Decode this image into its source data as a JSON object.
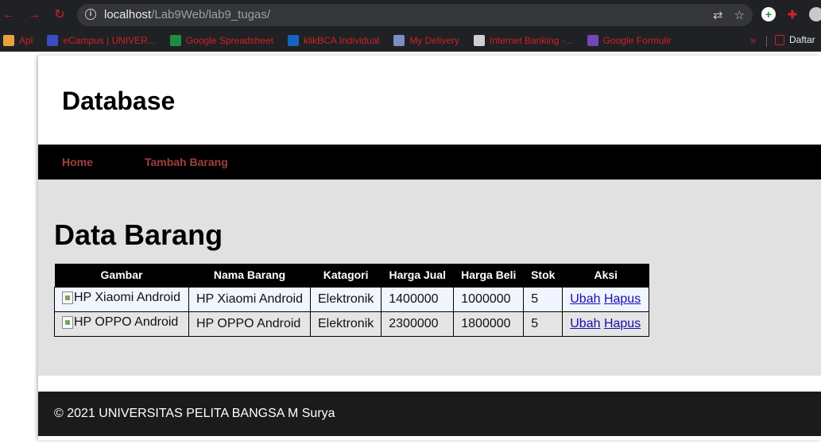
{
  "browser": {
    "url_host": "localhost",
    "url_path": "/Lab9Web/lab9_tugas/",
    "bookmarks": [
      {
        "label": "Apl",
        "color": "#e8a33d"
      },
      {
        "label": "eCampus | UNIVER...",
        "color": "#3b4cc0"
      },
      {
        "label": "Google Spreadsheet",
        "color": "#1e8e3e"
      },
      {
        "label": "klikBCA Individual",
        "color": "#1565c0"
      },
      {
        "label": "My Delivery",
        "color": "#7b8ec8"
      },
      {
        "label": "Internet Banking -...",
        "color": "#d0d0d0"
      },
      {
        "label": "Google Formulir",
        "color": "#7248b9"
      }
    ],
    "bookmarks_more": "»",
    "bookmark_daftar": "Daftar"
  },
  "header": {
    "title": "Database"
  },
  "nav": {
    "home": "Home",
    "tambah": "Tambah Barang"
  },
  "main": {
    "heading": "Data Barang",
    "columns": [
      "Gambar",
      "Nama Barang",
      "Katagori",
      "Harga Jual",
      "Harga Beli",
      "Stok",
      "Aksi"
    ],
    "rows": [
      {
        "gambar_alt": "HP Xiaomi Android",
        "nama": "HP Xiaomi Android",
        "kategori": "Elektronik",
        "harga_jual": "1400000",
        "harga_beli": "1000000",
        "stok": "5",
        "ubah": "Ubah",
        "hapus": "Hapus"
      },
      {
        "gambar_alt": "HP OPPO Android",
        "nama": "HP OPPO Android",
        "kategori": "Elektronik",
        "harga_jual": "2300000",
        "harga_beli": "1800000",
        "stok": "5",
        "ubah": "Ubah",
        "hapus": "Hapus"
      }
    ]
  },
  "footer": {
    "text": "© 2021 UNIVERSITAS PELITA BANGSA M Surya"
  },
  "colors": {
    "nav_link": "#a0413e",
    "footer_bg": "#1b1b1b",
    "main_bg": "#e1e1e1",
    "bookmark_text": "#cc2222"
  }
}
